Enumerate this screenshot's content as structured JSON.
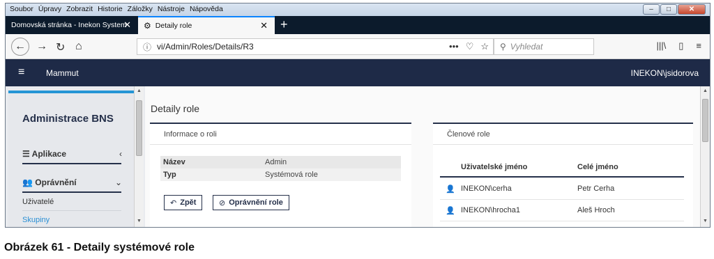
{
  "menu": [
    "Soubor",
    "Úpravy",
    "Zobrazit",
    "Historie",
    "Záložky",
    "Nástroje",
    "Nápověda"
  ],
  "window_controls": {
    "minimize": "–",
    "maximize": "□",
    "close": "✕"
  },
  "tabs": [
    {
      "label": "Domovská stránka - Inekon System",
      "close": "✕"
    },
    {
      "label": "Detaily role",
      "icon": "gear-icon",
      "close": "✕"
    }
  ],
  "new_tab": "+",
  "url": "vi/Admin/Roles/Details/R3",
  "search_placeholder": "Vyhledat",
  "app": {
    "name": "Mammut",
    "user": "INEKON\\jsidorova"
  },
  "sidebar": {
    "title": "Administrace BNS",
    "sections": [
      {
        "label": "Aplikace",
        "icon": "list-icon",
        "chevron": "‹"
      },
      {
        "label": "Oprávnění",
        "icon": "users-icon",
        "chevron": "⌄"
      }
    ],
    "links": [
      "Uživatelé",
      "Skupiny"
    ]
  },
  "page_title": "Detaily role",
  "role_info": {
    "heading": "Informace o roli",
    "rows": [
      {
        "key": "Název",
        "value": "Admin"
      },
      {
        "key": "Typ",
        "value": "Systémová role"
      }
    ],
    "back_button": "Zpět",
    "permissions_button": "Oprávnění role"
  },
  "members": {
    "heading": "Členové role",
    "columns": [
      "Uživatelské jméno",
      "Celé jméno"
    ],
    "rows": [
      {
        "username": "INEKON\\cerha",
        "fullname": "Petr Cerha"
      },
      {
        "username": "INEKON\\hrocha1",
        "fullname": "Aleš Hroch"
      }
    ]
  },
  "caption": "Obrázek 61 - Detaily systémové role",
  "colors": {
    "navy": "#1e2a47",
    "accent_blue": "#2595d5",
    "tab_dark": "#0c1b2c",
    "link_blue": "#2a8fd4"
  }
}
